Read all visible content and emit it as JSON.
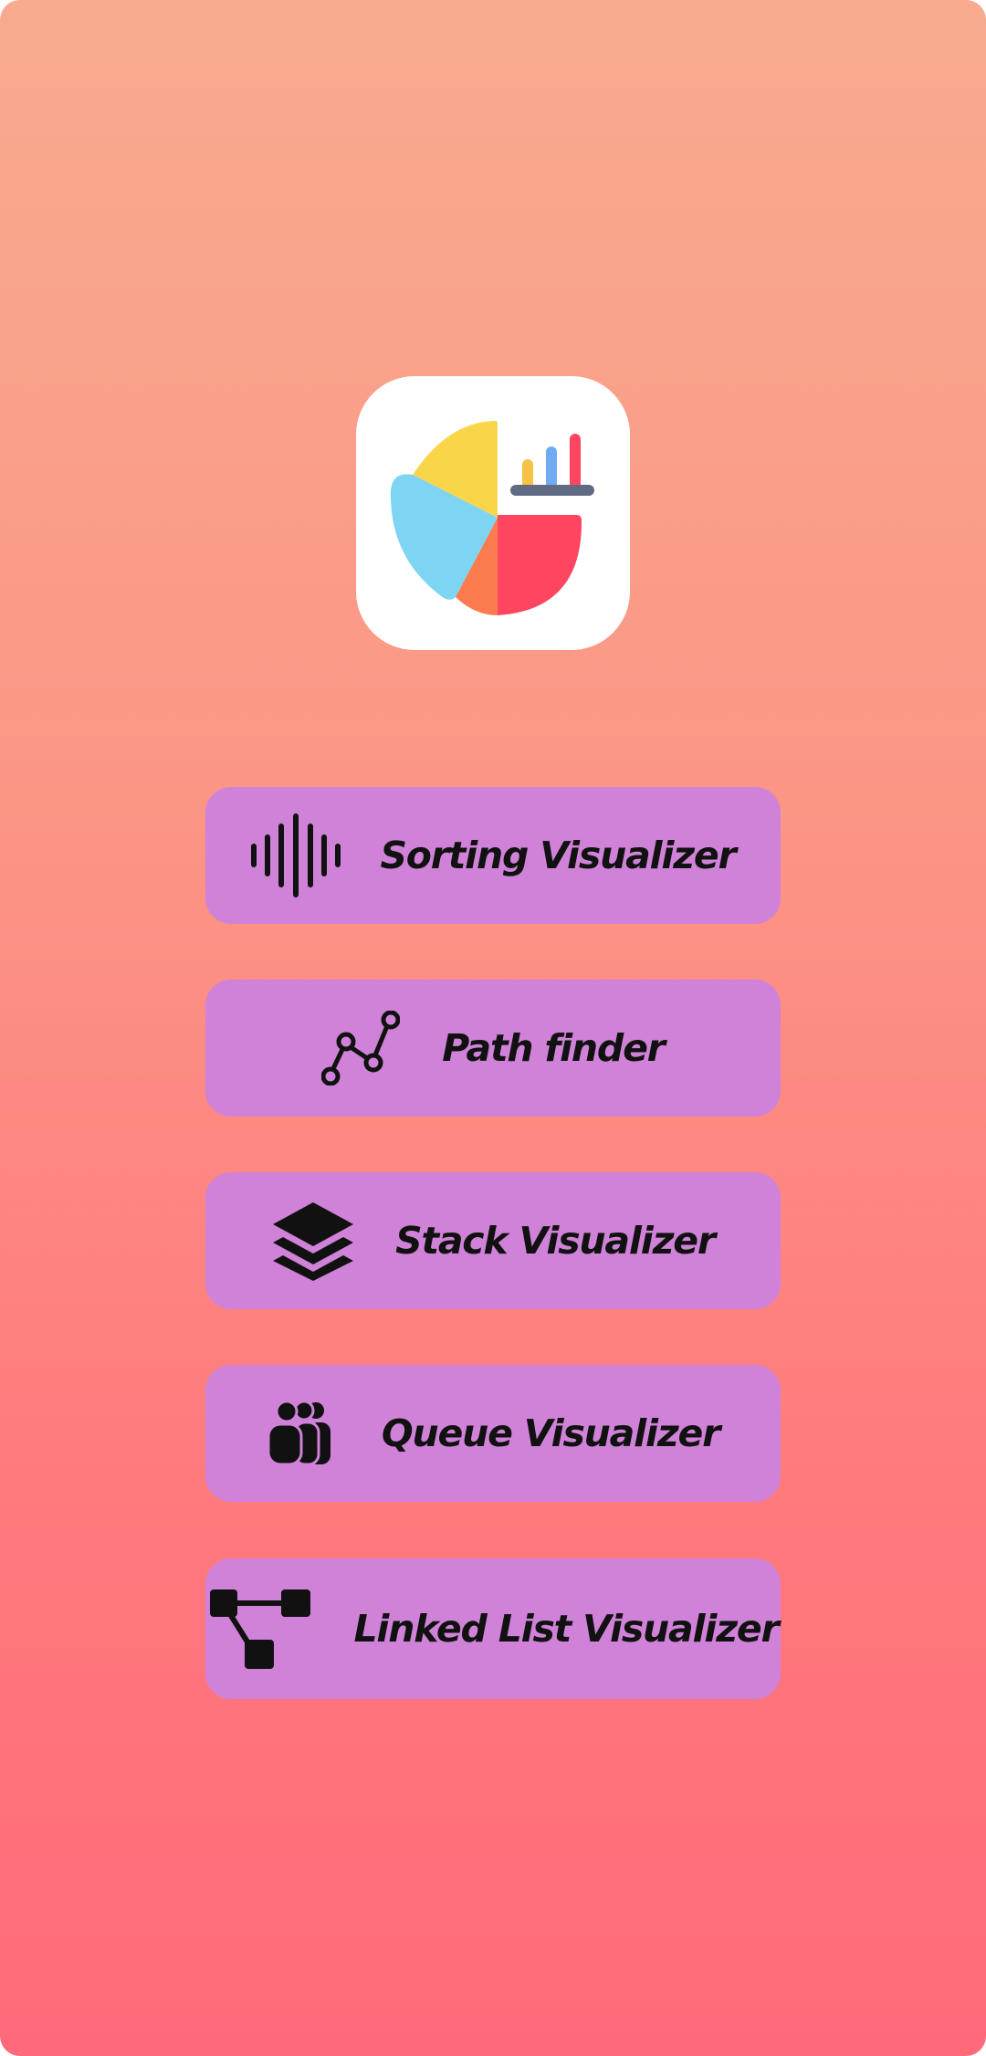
{
  "logo": {
    "icon": "pie-chart-app-logo",
    "colors": {
      "yellow": "#f9d649",
      "blue": "#7ed5f3",
      "orange": "#fc7b4f",
      "red": "#ff4560",
      "bar_yellow": "#f7c245",
      "bar_blue": "#72aaf2",
      "bar_red": "#ff4560",
      "baseline": "#606a83"
    }
  },
  "menu": {
    "items": [
      {
        "id": "sorting",
        "label": "Sorting Visualizer",
        "icon": "sound-wave-icon"
      },
      {
        "id": "path",
        "label": "Path finder",
        "icon": "line-graph-icon"
      },
      {
        "id": "stack",
        "label": "Stack Visualizer",
        "icon": "layers-icon"
      },
      {
        "id": "queue",
        "label": "Queue Visualizer",
        "icon": "people-queue-icon"
      },
      {
        "id": "linked_list",
        "label": "Linked List Visualizer",
        "icon": "node-tree-icon"
      }
    ],
    "button_color": "#d082d9",
    "text_color": "#111111"
  },
  "background": {
    "gradient_top": "#f8ab8f",
    "gradient_bottom": "#ff6a7a"
  }
}
